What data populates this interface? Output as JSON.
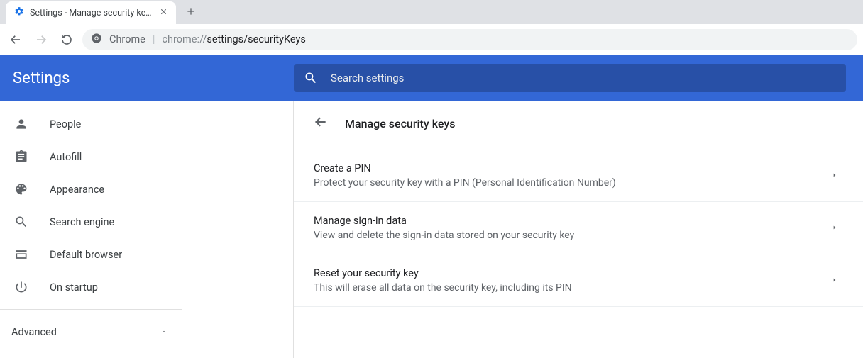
{
  "tab": {
    "title": "Settings - Manage security keys"
  },
  "omnibox": {
    "label": "Chrome",
    "prefix": "chrome://",
    "path": "settings/securityKeys"
  },
  "header": {
    "title": "Settings",
    "search_placeholder": "Search settings"
  },
  "sidebar": {
    "items": [
      {
        "label": "People"
      },
      {
        "label": "Autofill"
      },
      {
        "label": "Appearance"
      },
      {
        "label": "Search engine"
      },
      {
        "label": "Default browser"
      },
      {
        "label": "On startup"
      }
    ],
    "advanced_label": "Advanced"
  },
  "page": {
    "title": "Manage security keys",
    "rows": [
      {
        "title": "Create a PIN",
        "subtitle": "Protect your security key with a PIN (Personal Identification Number)"
      },
      {
        "title": "Manage sign-in data",
        "subtitle": "View and delete the sign-in data stored on your security key"
      },
      {
        "title": "Reset your security key",
        "subtitle": "This will erase all data on the security key, including its PIN"
      }
    ]
  }
}
